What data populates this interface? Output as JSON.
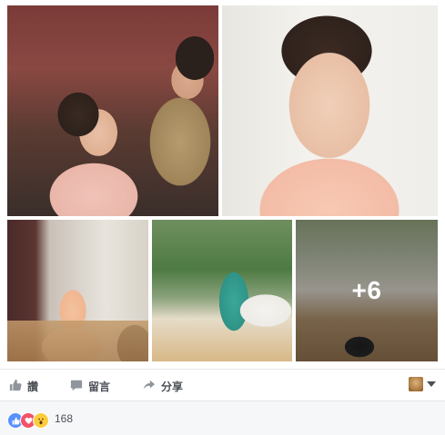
{
  "photos": {
    "tiles": [
      {
        "alt": "makeup-session"
      },
      {
        "alt": "portrait"
      },
      {
        "alt": "seated-pose"
      },
      {
        "alt": "yoga-pose"
      },
      {
        "alt": "photographer"
      }
    ],
    "more_overlay": "+6"
  },
  "actions": {
    "like_label": "讚",
    "comment_label": "留言",
    "share_label": "分享"
  },
  "reactions": {
    "types": [
      "like",
      "love",
      "wow"
    ],
    "count": "168"
  },
  "colors": {
    "icon_gray": "#90949c",
    "text_gray": "#4b4f56",
    "like_blue": "#5890ff",
    "love_red": "#f25268",
    "wow_yellow": "#fbcd3e"
  }
}
